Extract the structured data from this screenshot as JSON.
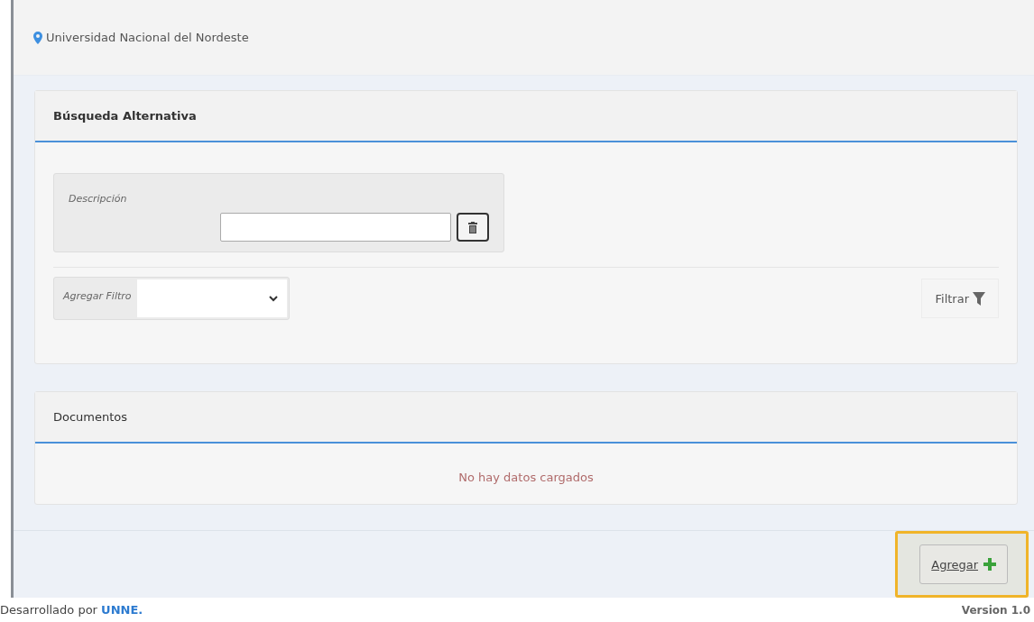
{
  "breadcrumb": "Universidad Nacional del Nordeste",
  "search_panel": {
    "title": "Búsqueda Alternativa",
    "description_label": "Descripción",
    "add_filter_label": "Agregar Filtro",
    "filter_button": "Filtrar"
  },
  "documents_panel": {
    "title": "Documentos",
    "empty_message": "No hay datos cargados"
  },
  "add_button": {
    "label": "Agregar",
    "highlighted": true
  },
  "footer": {
    "credit_prefix": "Desarrollado por",
    "credit_link": "UNNE.",
    "version": "Version 1.0"
  }
}
